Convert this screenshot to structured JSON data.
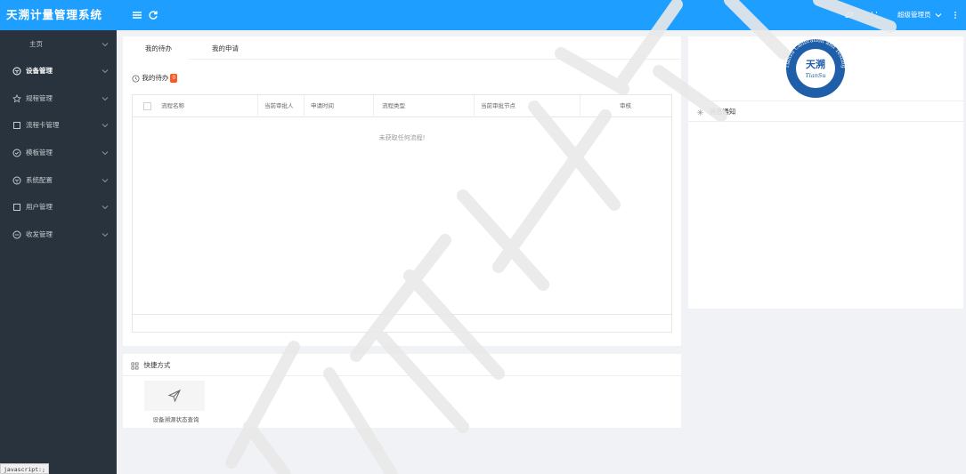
{
  "header": {
    "app_title": "天溯计量管理系统",
    "user_label": "超级管理员",
    "colors": {
      "primary": "#1e9fff",
      "sidebar": "#28333e",
      "badge": "#ff5722"
    }
  },
  "sidebar": {
    "items": [
      {
        "label": "主页",
        "icon": "none"
      },
      {
        "label": "设备管理",
        "icon": "cube-icon"
      },
      {
        "label": "规程管理",
        "icon": "star-icon"
      },
      {
        "label": "流程卡管理",
        "icon": "square-icon"
      },
      {
        "label": "模板管理",
        "icon": "shield-icon"
      },
      {
        "label": "系统配置",
        "icon": "cube-icon"
      },
      {
        "label": "用户管理",
        "icon": "square-icon"
      },
      {
        "label": "收发管理",
        "icon": "minus-circle-icon"
      }
    ],
    "status_tip": "javascript:;"
  },
  "main": {
    "tabs": [
      {
        "label": "我的待办"
      },
      {
        "label": "我的申请"
      }
    ],
    "todo_title": "我的待办",
    "todo_count": "0",
    "table": {
      "columns": [
        "流程名称",
        "当前审批人",
        "申请时间",
        "流程类型",
        "当前审批节点",
        "审核"
      ],
      "empty_text": "未获取任何流程!"
    },
    "shortcuts": {
      "title": "快捷方式",
      "items": [
        {
          "label": "设备溯源状态查询",
          "icon": "paper-plane-icon"
        }
      ]
    }
  },
  "right_panel": {
    "logo_text": "天溯",
    "logo_ring_text": "Tianzu Calibration and Testing",
    "logo_script": "TianSu",
    "notice_title": "消息通知"
  }
}
